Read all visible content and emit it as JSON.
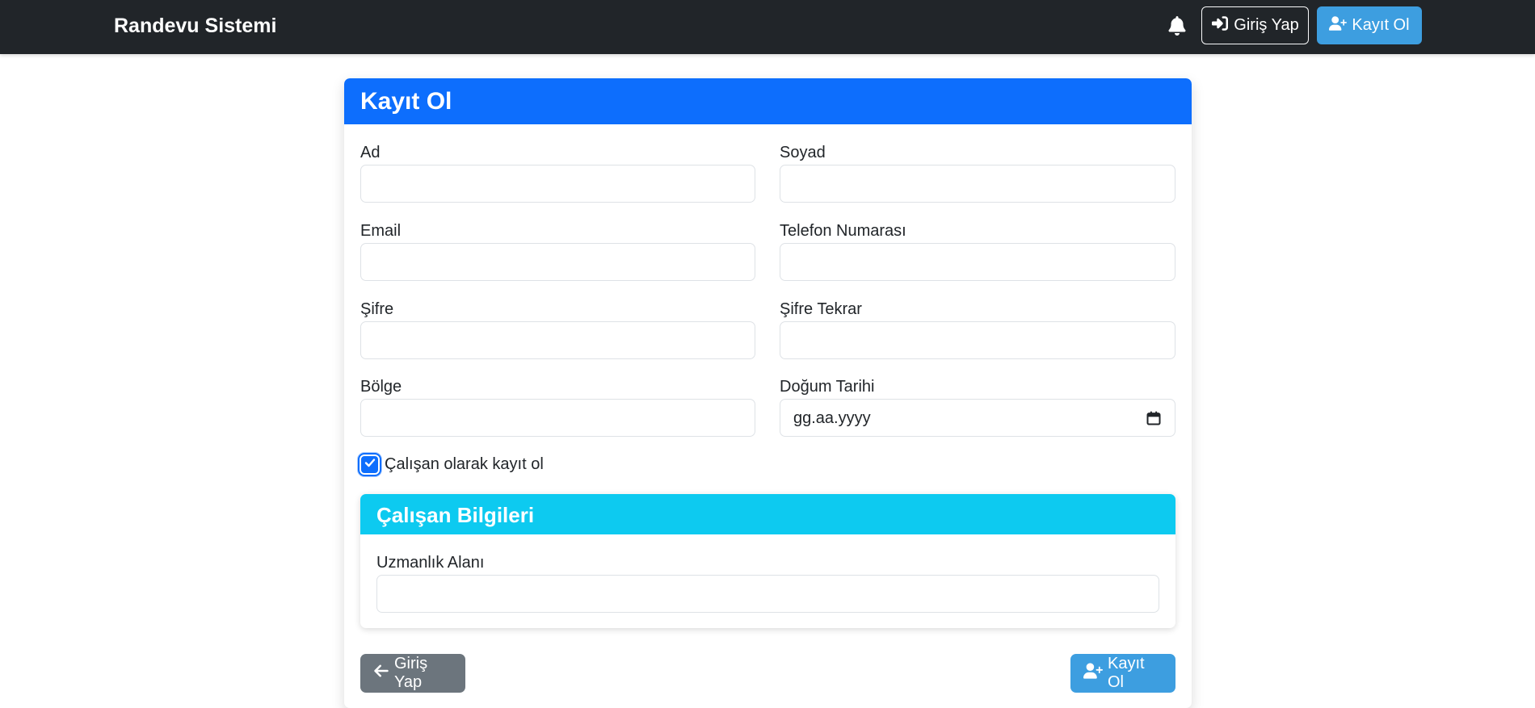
{
  "navbar": {
    "brand": "Randevu Sistemi",
    "login_label": "Giriş Yap",
    "register_label": "Kayıt Ol"
  },
  "form": {
    "title": "Kayıt Ol",
    "fields": {
      "first_name": {
        "label": "Ad",
        "value": ""
      },
      "last_name": {
        "label": "Soyad",
        "value": ""
      },
      "email": {
        "label": "Email",
        "value": ""
      },
      "phone": {
        "label": "Telefon Numarası",
        "value": ""
      },
      "password": {
        "label": "Şifre",
        "value": ""
      },
      "password_repeat": {
        "label": "Şifre Tekrar",
        "value": ""
      },
      "region": {
        "label": "Bölge",
        "value": ""
      },
      "birth_date": {
        "label": "Doğum Tarihi",
        "placeholder": "gg.aa.yyyy"
      }
    },
    "employee_checkbox": {
      "label": "Çalışan olarak kayıt ol",
      "checked": true
    },
    "employee_section": {
      "title": "Çalışan Bilgileri",
      "specialty": {
        "label": "Uzmanlık Alanı",
        "value": ""
      }
    },
    "back_button_label": "Giriş Yap",
    "submit_button_label": "Kayıt Ol"
  },
  "icons": {
    "notification": "bell-icon",
    "login": "sign-in-icon",
    "register": "user-plus-icon",
    "back": "arrow-left-icon",
    "calendar": "calendar-icon",
    "check": "check-icon"
  },
  "colors": {
    "navbar_bg": "#212529",
    "primary": "#0d6efd",
    "info": "#0dcaf0",
    "secondary": "#6c757d",
    "accent_button": "#3d9ee0"
  }
}
